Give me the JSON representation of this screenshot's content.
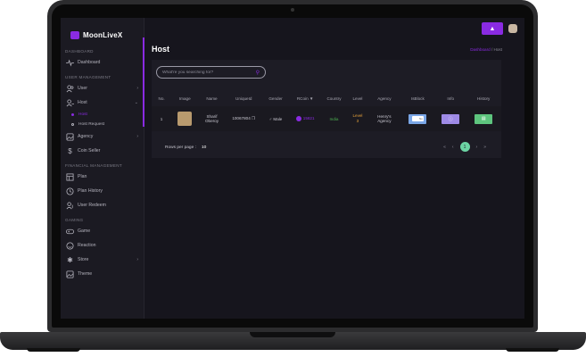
{
  "app": {
    "name": "MoonLiveX"
  },
  "sidebar": {
    "sections": {
      "dashboard": "DASHBOARD",
      "user_management": "USER MANAGEMENT",
      "financial_management": "FINANCIAL MANAGEMENT",
      "gaming": "GAMING"
    },
    "items": {
      "dashboard": "Dashboard",
      "user": "User",
      "host": "Host",
      "host_sub": "Host",
      "host_request": "Host Request",
      "agency": "Agency",
      "coin_seller": "Coin Seller",
      "plan": "Plan",
      "plan_history": "Plan History",
      "user_redeem": "User Redeem",
      "game": "Game",
      "reaction": "Reaction",
      "store": "Store",
      "theme": "Theme"
    }
  },
  "page": {
    "title": "Host",
    "breadcrumb": {
      "home": "Dashboard",
      "separator": "/",
      "current": "Host"
    }
  },
  "search": {
    "placeholder": "What're you searching for?"
  },
  "table": {
    "headers": [
      "No.",
      "Image",
      "Name",
      "UniqueId",
      "Gender",
      "RCoin",
      "Country",
      "Level",
      "Agency",
      "IsBlock",
      "Info",
      "History"
    ],
    "rows": [
      {
        "no": "1",
        "name_line1": "Sharif",
        "name_line2": "Oberoy",
        "unique_id": "10067804",
        "gender": "Male",
        "rcoin": "15821",
        "country": "India",
        "level_line1": "Level",
        "level_line2": "3",
        "agency_line1": "Henry's",
        "agency_line2": "Agency",
        "isblock": "No"
      }
    ]
  },
  "pagination": {
    "rows_label": "Rows per page :",
    "rows_value": "10",
    "prev2": "«",
    "prev": "‹",
    "current": "1",
    "next": "›",
    "next2": "»"
  },
  "colors": {
    "accent": "#8a2be2",
    "page_bg": "#16151d",
    "card_bg": "#1d1c25",
    "country": "#4caf50",
    "level": "#e8a33a",
    "current_page": "#6cd4a4"
  }
}
